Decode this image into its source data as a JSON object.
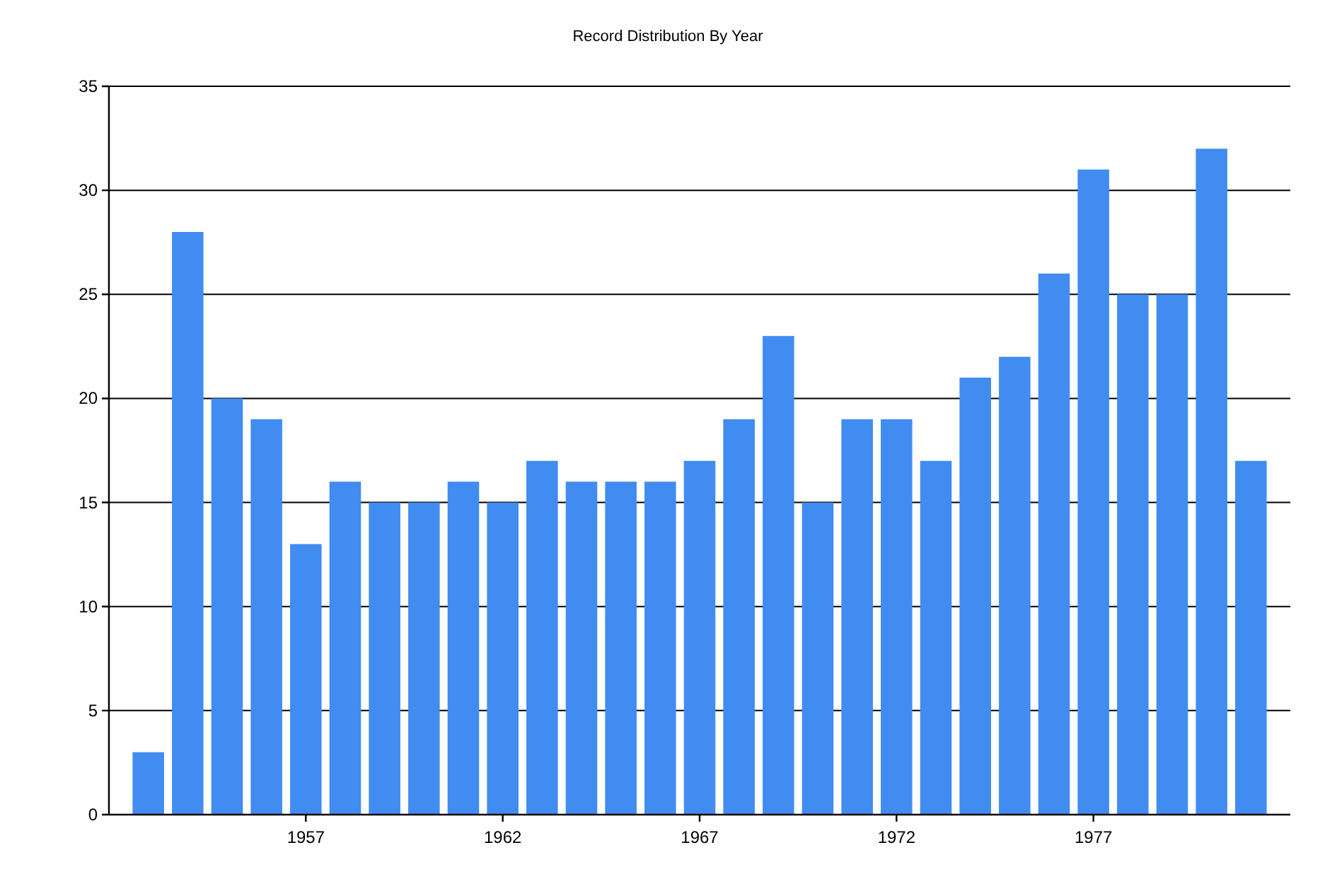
{
  "chart_data": {
    "type": "bar",
    "title": "Record Distribution By Year",
    "x": [
      1953,
      1954,
      1955,
      1956,
      1957,
      1958,
      1959,
      1960,
      1961,
      1962,
      1963,
      1964,
      1965,
      1966,
      1967,
      1968,
      1969,
      1970,
      1971,
      1972,
      1973,
      1974,
      1975,
      1976,
      1977,
      1978,
      1979,
      1980,
      1981
    ],
    "grid": true,
    "series": [
      {
        "color": "#418cf0",
        "values": [
          3,
          28,
          20,
          19,
          13,
          16,
          15,
          15,
          16,
          15,
          17,
          16,
          16,
          16,
          17,
          19,
          23,
          15,
          19,
          19,
          17,
          21,
          22,
          26,
          31,
          25,
          25,
          32,
          17
        ]
      }
    ],
    "xlim": [
      1952,
      1982
    ],
    "ylim": [
      0,
      35
    ],
    "xticks": [
      1957,
      1962,
      1967,
      1972,
      1977
    ],
    "yticks": [
      0,
      5,
      10,
      15,
      20,
      25,
      30,
      35
    ]
  }
}
